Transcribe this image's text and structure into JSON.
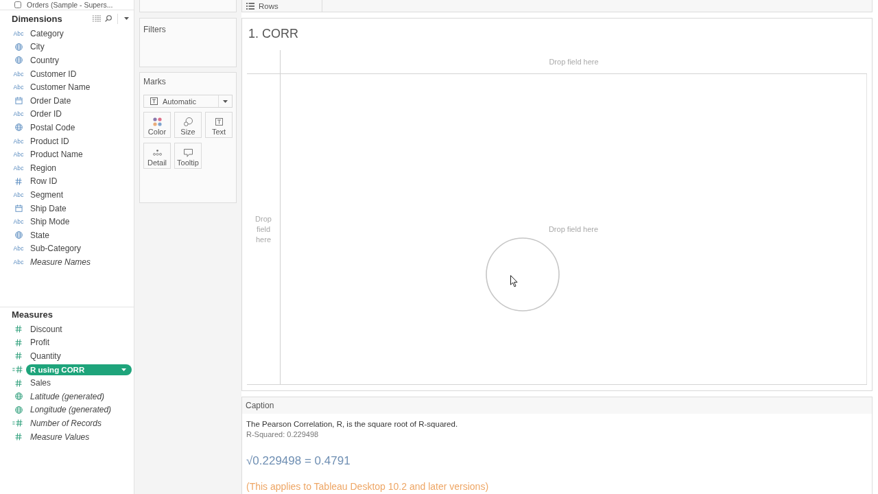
{
  "data_source": {
    "name": "Orders (Sample - Supers..."
  },
  "dimensions": {
    "title": "Dimensions",
    "fields": [
      {
        "name": "Category",
        "kind": "string",
        "type_label": "Abc",
        "generated": false,
        "selected": false
      },
      {
        "name": "City",
        "kind": "geo",
        "generated": false,
        "selected": false
      },
      {
        "name": "Country",
        "kind": "geo",
        "generated": false,
        "selected": false
      },
      {
        "name": "Customer ID",
        "kind": "string",
        "type_label": "Abc",
        "generated": false,
        "selected": false
      },
      {
        "name": "Customer Name",
        "kind": "string",
        "type_label": "Abc",
        "generated": false,
        "selected": false
      },
      {
        "name": "Order Date",
        "kind": "date",
        "generated": false,
        "selected": false
      },
      {
        "name": "Order ID",
        "kind": "string",
        "type_label": "Abc",
        "generated": false,
        "selected": false
      },
      {
        "name": "Postal Code",
        "kind": "geo",
        "generated": false,
        "selected": false
      },
      {
        "name": "Product ID",
        "kind": "string",
        "type_label": "Abc",
        "generated": false,
        "selected": false
      },
      {
        "name": "Product Name",
        "kind": "string",
        "type_label": "Abc",
        "generated": false,
        "selected": false
      },
      {
        "name": "Region",
        "kind": "string",
        "type_label": "Abc",
        "generated": false,
        "selected": false
      },
      {
        "name": "Row ID",
        "kind": "number",
        "generated": false,
        "selected": false
      },
      {
        "name": "Segment",
        "kind": "string",
        "type_label": "Abc",
        "generated": false,
        "selected": false
      },
      {
        "name": "Ship Date",
        "kind": "date",
        "generated": false,
        "selected": false
      },
      {
        "name": "Ship Mode",
        "kind": "string",
        "type_label": "Abc",
        "generated": false,
        "selected": false
      },
      {
        "name": "State",
        "kind": "geo",
        "generated": false,
        "selected": false
      },
      {
        "name": "Sub-Category",
        "kind": "string",
        "type_label": "Abc",
        "generated": false,
        "selected": false
      },
      {
        "name": "Measure Names",
        "kind": "string",
        "type_label": "Abc",
        "generated": true,
        "selected": false
      }
    ]
  },
  "measures": {
    "title": "Measures",
    "fields": [
      {
        "name": "Discount",
        "kind": "number",
        "generated": false,
        "selected": false
      },
      {
        "name": "Profit",
        "kind": "number",
        "generated": false,
        "selected": false
      },
      {
        "name": "Quantity",
        "kind": "number",
        "generated": false,
        "selected": false
      },
      {
        "name": "R using CORR",
        "kind": "calc",
        "generated": false,
        "selected": true
      },
      {
        "name": "Sales",
        "kind": "number",
        "generated": false,
        "selected": false
      },
      {
        "name": "Latitude (generated)",
        "kind": "geo",
        "generated": true,
        "selected": false
      },
      {
        "name": "Longitude (generated)",
        "kind": "geo",
        "generated": true,
        "selected": false
      },
      {
        "name": "Number of Records",
        "kind": "calc",
        "generated": true,
        "selected": false
      },
      {
        "name": "Measure Values",
        "kind": "number",
        "generated": true,
        "selected": false
      }
    ]
  },
  "shelves": {
    "rows_label": "Rows",
    "filters_title": "Filters"
  },
  "marks": {
    "title": "Marks",
    "mark_type": "Automatic",
    "cards": [
      {
        "kind": "color",
        "label": "Color"
      },
      {
        "kind": "size",
        "label": "Size"
      },
      {
        "kind": "text",
        "label": "Text"
      },
      {
        "kind": "detail",
        "label": "Detail"
      },
      {
        "kind": "tooltip",
        "label": "Tooltip"
      }
    ]
  },
  "view": {
    "title": "1. CORR",
    "columns_hint": "Drop field here",
    "rows_hint": "Drop field here",
    "body_hint": "Drop field here"
  },
  "caption": {
    "title": "Caption",
    "lines": [
      {
        "kind": "body",
        "text": "The Pearson Correlation, R, is the square root of R-squared."
      },
      {
        "kind": "sub",
        "text": "R-Squared: 0.229498"
      },
      {
        "kind": "formula",
        "text": "√0.229498 = 0.4791"
      },
      {
        "kind": "note",
        "text": "(This applies to Tableau Desktop 10.2 and later versions)"
      }
    ]
  }
}
